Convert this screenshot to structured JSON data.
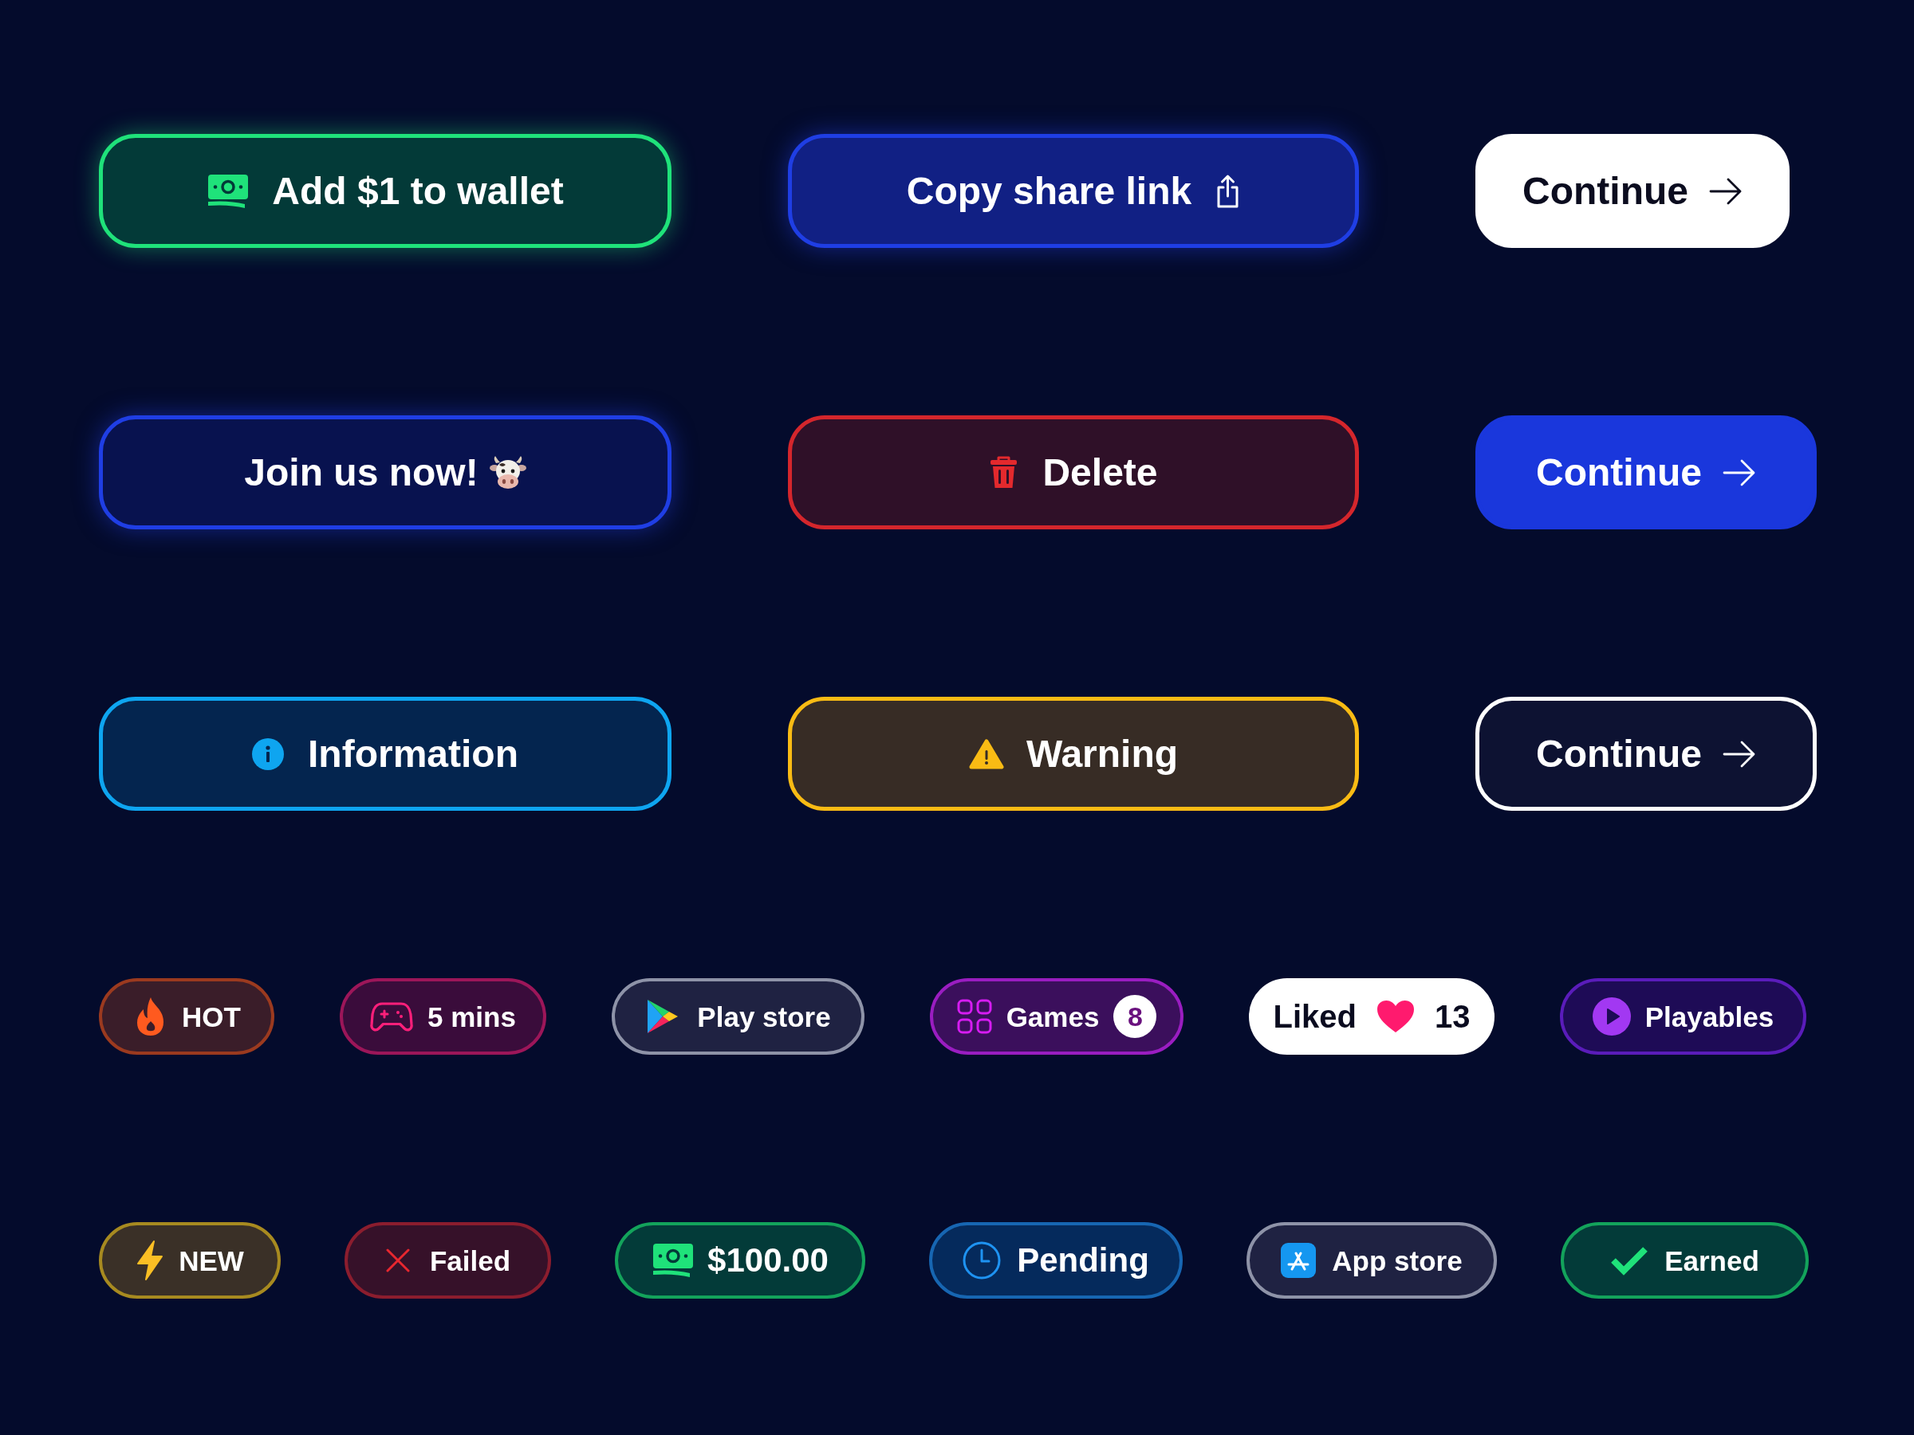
{
  "button_rows": [
    [
      {
        "kind": "wallet",
        "label": "Add $1 to wallet"
      },
      {
        "kind": "share",
        "label": "Copy share link"
      },
      {
        "kind": "light",
        "label": "Continue"
      }
    ],
    [
      {
        "kind": "join",
        "label": "Join us now!"
      },
      {
        "kind": "delete",
        "label": "Delete"
      },
      {
        "kind": "filled",
        "label": "Continue"
      }
    ],
    [
      {
        "kind": "info",
        "label": "Information"
      },
      {
        "kind": "warning",
        "label": "Warning"
      },
      {
        "kind": "outline",
        "label": "Continue"
      }
    ]
  ],
  "badge_rows": [
    [
      {
        "kind": "hot",
        "label": "HOT"
      },
      {
        "kind": "timer",
        "label": "5 mins"
      },
      {
        "kind": "playstore",
        "label": "Play store"
      },
      {
        "kind": "games",
        "label": "Games",
        "count": "8"
      },
      {
        "kind": "liked",
        "label": "Liked",
        "count": "13"
      },
      {
        "kind": "playables",
        "label": "Playables"
      }
    ],
    [
      {
        "kind": "new",
        "label": "NEW"
      },
      {
        "kind": "failed",
        "label": "Failed"
      },
      {
        "kind": "money",
        "label": "$100.00"
      },
      {
        "kind": "pending",
        "label": "Pending"
      },
      {
        "kind": "appstore",
        "label": "App store"
      },
      {
        "kind": "earned",
        "label": "Earned"
      }
    ]
  ]
}
